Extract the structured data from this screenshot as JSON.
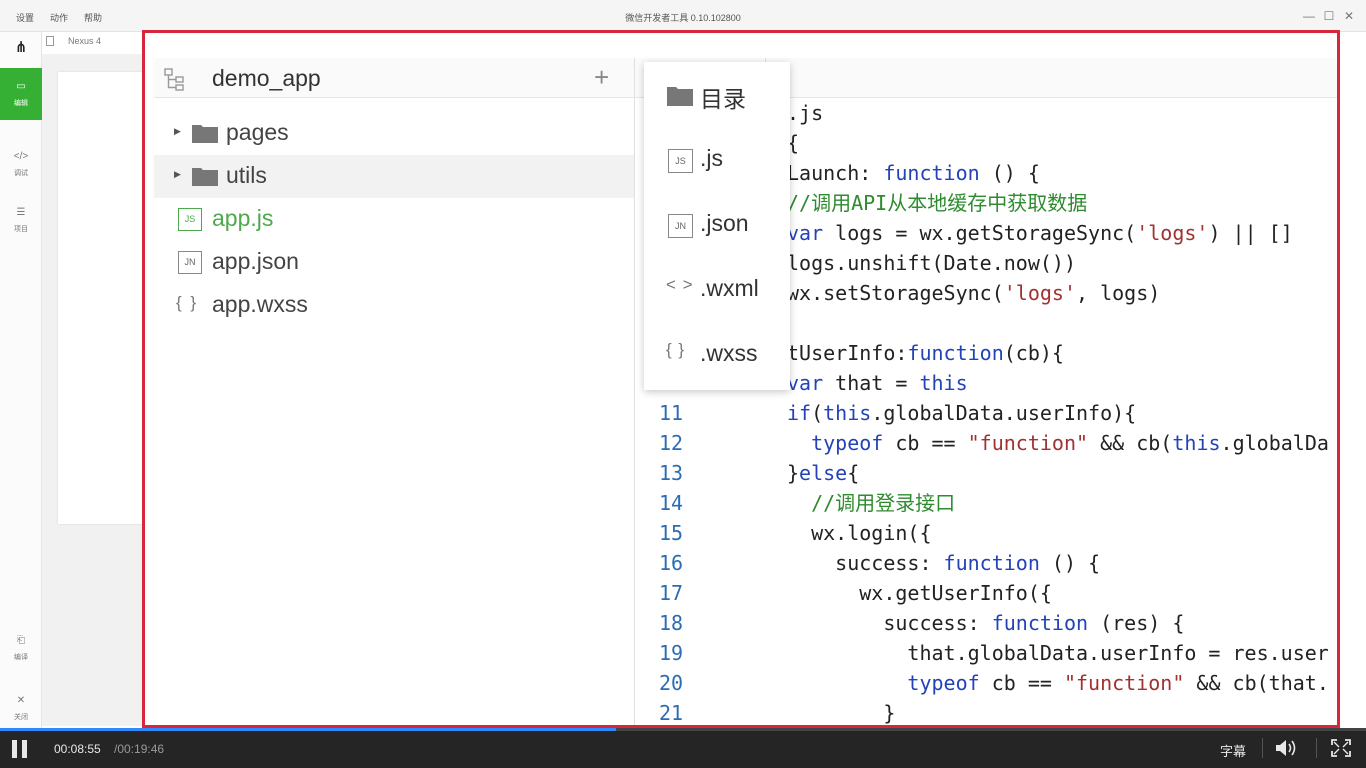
{
  "titlebar": {
    "menu": [
      "设置",
      "动作",
      "帮助"
    ],
    "title": "微信开发者工具 0.10.102800"
  },
  "sidebar": {
    "items": [
      {
        "icon": "edit-icon",
        "label": "编辑",
        "active": true
      },
      {
        "icon": "debug-icon",
        "label": "调试",
        "active": false
      },
      {
        "icon": "project-icon",
        "label": "项目",
        "active": false
      },
      {
        "icon": "compile-icon",
        "label": "编译",
        "active": false
      },
      {
        "icon": "close-icon",
        "label": "关闭",
        "active": false
      }
    ]
  },
  "device": {
    "name": "Nexus 4"
  },
  "file_tree": {
    "project_name": "demo_app",
    "items": [
      {
        "type": "folder",
        "label": "pages"
      },
      {
        "type": "folder",
        "label": "utils"
      },
      {
        "type": "js",
        "badge": "JS",
        "label": "app.js"
      },
      {
        "type": "json",
        "badge": "JN",
        "label": "app.json"
      },
      {
        "type": "wxss",
        "badge": "{ }",
        "label": "app.wxss"
      }
    ]
  },
  "new_menu": {
    "items": [
      {
        "icon": "folder-icon",
        "label": "目录"
      },
      {
        "icon": "js-file-icon",
        "badge": "JS",
        "label": ".js"
      },
      {
        "icon": "json-file-icon",
        "badge": "JN",
        "label": ".json"
      },
      {
        "icon": "wxml-file-icon",
        "badge": "< >",
        "label": ".wxml"
      },
      {
        "icon": "wxss-file-icon",
        "badge": "{ }",
        "label": ".wxss"
      }
    ]
  },
  "editor": {
    "lines": [
      {
        "num": "",
        "text": ".js"
      },
      {
        "num": "",
        "text": "{"
      },
      {
        "num": "",
        "text": "Launch: function () {"
      },
      {
        "num": "",
        "text": "//调用API从本地缓存中获取数据"
      },
      {
        "num": "",
        "text": "var logs = wx.getStorageSync('logs') || []"
      },
      {
        "num": "",
        "text": "logs.unshift(Date.now())"
      },
      {
        "num": "",
        "text": "wx.setStorageSync('logs', logs)"
      },
      {
        "num": "",
        "text": ""
      },
      {
        "num": "",
        "text": "tUserInfo:function(cb){"
      },
      {
        "num": "",
        "text": "var that = this"
      },
      {
        "num": "11",
        "text": "if(this.globalData.userInfo){"
      },
      {
        "num": "12",
        "text": "  typeof cb == \"function\" && cb(this.globalDa"
      },
      {
        "num": "13",
        "text": "}else{"
      },
      {
        "num": "14",
        "text": "  //调用登录接口"
      },
      {
        "num": "15",
        "text": "  wx.login({"
      },
      {
        "num": "16",
        "text": "    success: function () {"
      },
      {
        "num": "17",
        "text": "      wx.getUserInfo({"
      },
      {
        "num": "18",
        "text": "        success: function (res) {"
      },
      {
        "num": "19",
        "text": "          that.globalData.userInfo = res.user"
      },
      {
        "num": "20",
        "text": "          typeof cb == \"function\" && cb(that."
      },
      {
        "num": "21",
        "text": "        }"
      }
    ]
  },
  "player": {
    "current_time": "00:08:55",
    "total_time": "/00:19:46",
    "progress": 0.451,
    "subtitle_label": "字幕"
  },
  "colors": {
    "accent_green": "#35b035",
    "frame_red": "#d8263a",
    "keyword_blue": "#2342b8",
    "string_red": "#a23131",
    "comment_green": "#2e8b2e",
    "line_number_blue": "#2b6cb3",
    "progress_blue": "#2e89ff"
  }
}
